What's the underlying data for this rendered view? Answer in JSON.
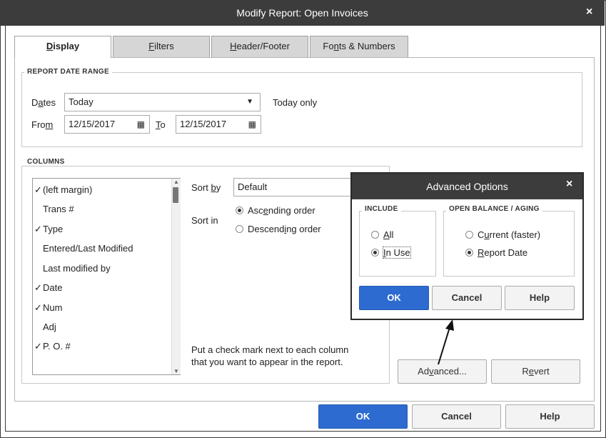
{
  "window": {
    "title": "Modify Report: Open Invoices",
    "close_glyph": "×"
  },
  "tabs": [
    {
      "label_pre": "",
      "label_u": "D",
      "label_post": "isplay"
    },
    {
      "label_pre": "",
      "label_u": "F",
      "label_post": "ilters"
    },
    {
      "label_pre": "",
      "label_u": "H",
      "label_post": "eader/Footer"
    },
    {
      "label_pre": "Fo",
      "label_u": "n",
      "label_post": "ts & Numbers"
    }
  ],
  "date_range": {
    "group_label": "REPORT DATE RANGE",
    "dates_label_pre": "D",
    "dates_label_u": "a",
    "dates_label_post": "tes",
    "dates_value": "Today",
    "dates_note": "Today only",
    "from_label_pre": "Fro",
    "from_label_u": "m",
    "from_label_post": "",
    "from_value": "12/15/2017",
    "to_label_u": "T",
    "to_label_post": "o",
    "to_value": "12/15/2017"
  },
  "columns": {
    "group_label": "COLUMNS",
    "items": [
      {
        "label": "(left margin)",
        "check": "✓"
      },
      {
        "label": "Trans #",
        "check": ""
      },
      {
        "label": "Type",
        "check": "✓"
      },
      {
        "label": "Entered/Last Modified",
        "check": ""
      },
      {
        "label": "Last modified by",
        "check": ""
      },
      {
        "label": "Date",
        "check": "✓"
      },
      {
        "label": "Num",
        "check": "✓"
      },
      {
        "label": "Adj",
        "check": ""
      },
      {
        "label": "P. O. #",
        "check": "✓"
      }
    ],
    "sort_by_pre": "Sort ",
    "sort_by_u": "b",
    "sort_by_post": "y",
    "sort_by_value": "Default",
    "sort_in_label": "Sort in",
    "ascending_pre": "Asc",
    "ascending_u": "e",
    "ascending_post": "nding order",
    "descending_pre": "Descend",
    "descending_u": "i",
    "descending_post": "ng order",
    "sort_order_selected": "ascending",
    "hint_line1": "Put a check mark next to each column",
    "hint_line2": "that you want to appear in the report.",
    "advanced_pre": "Ad",
    "advanced_u": "v",
    "advanced_post": "anced...",
    "revert_pre": "R",
    "revert_u": "e",
    "revert_post": "vert"
  },
  "footer": {
    "ok": "OK",
    "cancel": "Cancel",
    "help": "Help"
  },
  "advanced_dialog": {
    "title": "Advanced Options",
    "close_glyph": "×",
    "include_label": "INCLUDE",
    "include_all_u": "A",
    "include_all_post": "ll",
    "include_inuse_u": "I",
    "include_inuse_post": "n Use",
    "include_selected": "in_use",
    "aging_label": "OPEN BALANCE / AGING",
    "current_pre": "C",
    "current_u": "u",
    "current_post": "rrent (faster)",
    "report_date_u": "R",
    "report_date_post": "eport Date",
    "aging_selected": "report_date",
    "ok": "OK",
    "cancel": "Cancel",
    "help": "Help"
  },
  "colors": {
    "titlebar": "#3c3c3c",
    "primary_button": "#2d6bd0",
    "tab_inactive": "#d6d6d6"
  },
  "icons": {
    "calendar": "calendar-icon",
    "dropdown": "chevron-down-icon",
    "close": "close-icon"
  }
}
